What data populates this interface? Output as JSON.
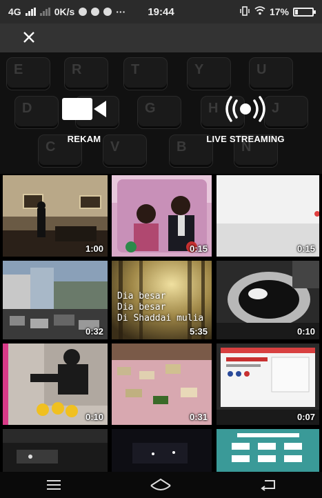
{
  "status_bar": {
    "network": "4G",
    "speed": "0K/s",
    "more": "···",
    "time": "19:44",
    "battery": "17%",
    "battery_level": 0.17
  },
  "top": {
    "close_icon": "close-icon",
    "keyboard_keys": [
      "E",
      "R",
      "T",
      "Y",
      "U",
      "D",
      "F",
      "G",
      "H",
      "J",
      "C",
      "V",
      "B",
      "N"
    ],
    "record_label": "REKAM",
    "live_label": "LIVE STREAMING"
  },
  "gallery": {
    "items": [
      {
        "duration": "1:00"
      },
      {
        "duration": "0:15"
      },
      {
        "duration": "0:15"
      },
      {
        "duration": "0:32"
      },
      {
        "duration": "5:35",
        "overlay": [
          "Dia besar",
          "Dia besar",
          "Di Shaddai mulia"
        ]
      },
      {
        "duration": "0:10"
      },
      {
        "duration": "0:10"
      },
      {
        "duration": "0:31"
      },
      {
        "duration": "0:07"
      },
      {
        "duration": ""
      },
      {
        "duration": ""
      },
      {
        "duration": ""
      }
    ]
  },
  "nav": {
    "menu_icon": "menu-icon",
    "home_icon": "home-icon",
    "back_icon": "back-icon"
  }
}
